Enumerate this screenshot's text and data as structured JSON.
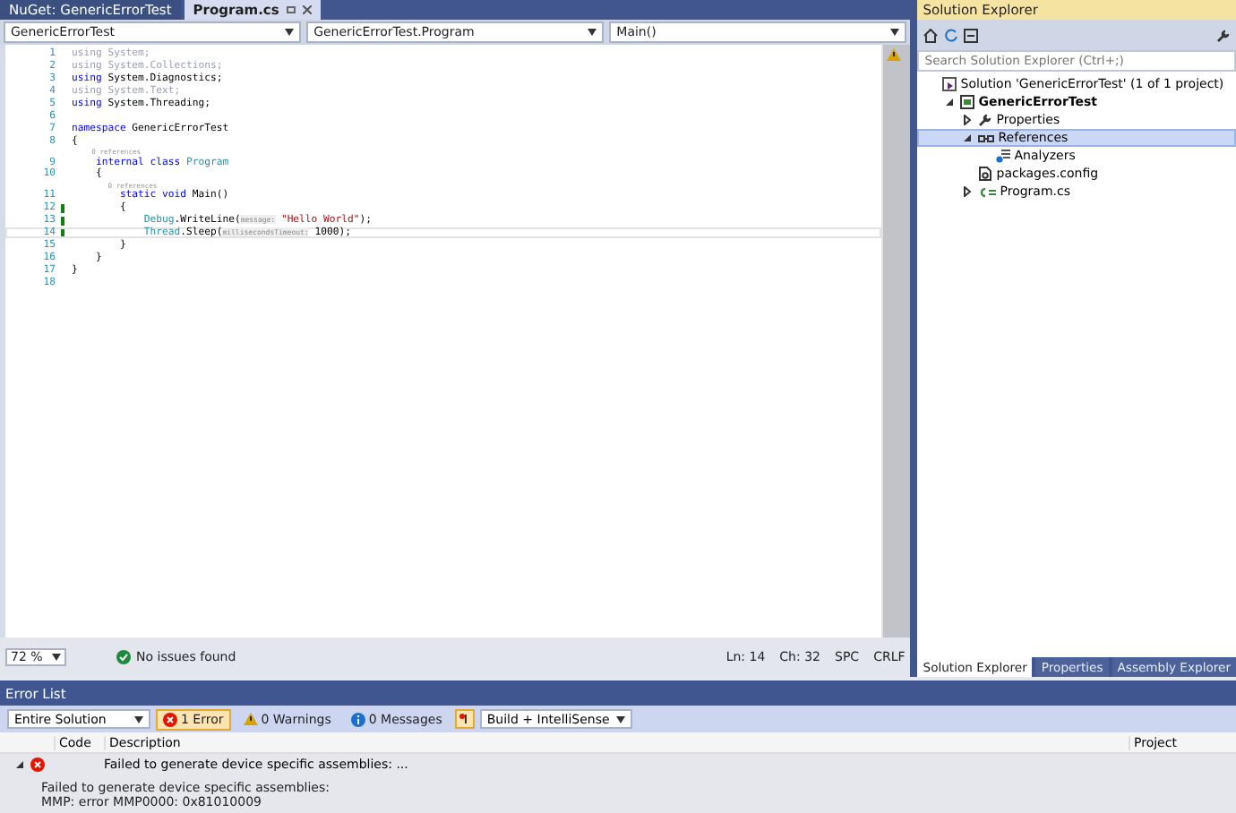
{
  "doc_tabs": [
    {
      "label": "NuGet: GenericErrorTest",
      "selected": false
    },
    {
      "label": "Program.cs",
      "selected": true
    }
  ],
  "nav_bar": [
    "GenericErrorTest",
    "GenericErrorTest.Program",
    "Main()"
  ],
  "code_lines": [
    {
      "kind": "code",
      "number": "1",
      "changed": false,
      "current": false,
      "tokens": [
        {
          "text": "using System;",
          "kind": "dim"
        }
      ]
    },
    {
      "kind": "code",
      "number": "2",
      "changed": false,
      "current": false,
      "tokens": [
        {
          "text": "using System.Collections;",
          "kind": "dim"
        }
      ]
    },
    {
      "kind": "code",
      "number": "3",
      "changed": false,
      "current": false,
      "tokens": [
        {
          "text": "using",
          "kind": "keyword"
        },
        {
          "text": " System.Diagnostics;",
          "kind": "plain"
        }
      ]
    },
    {
      "kind": "code",
      "number": "4",
      "changed": false,
      "current": false,
      "tokens": [
        {
          "text": "using System.Text;",
          "kind": "dim"
        }
      ]
    },
    {
      "kind": "code",
      "number": "5",
      "changed": false,
      "current": false,
      "tokens": [
        {
          "text": "using",
          "kind": "keyword"
        },
        {
          "text": " System.Threading;",
          "kind": "plain"
        }
      ]
    },
    {
      "kind": "code",
      "number": "6",
      "changed": false,
      "current": false
    },
    {
      "kind": "code",
      "number": "7",
      "changed": false,
      "current": false,
      "tokens": [
        {
          "text": "namespace",
          "kind": "keyword"
        },
        {
          "text": " GenericErrorTest",
          "kind": "plain"
        }
      ]
    },
    {
      "kind": "code",
      "number": "8",
      "changed": false,
      "current": false,
      "tokens": [
        {
          "text": "{",
          "kind": "plain"
        }
      ]
    },
    {
      "kind": "lens",
      "text": "    0 references"
    },
    {
      "kind": "code",
      "number": "9",
      "changed": false,
      "current": false,
      "tokens": [
        {
          "text": "    internal class ",
          "kind": "keyword"
        },
        {
          "text": "Program",
          "kind": "type"
        }
      ]
    },
    {
      "kind": "code",
      "number": "10",
      "changed": false,
      "current": false,
      "tokens": [
        {
          "text": "    {",
          "kind": "plain"
        }
      ]
    },
    {
      "kind": "lens",
      "text": "        0 references"
    },
    {
      "kind": "code",
      "number": "11",
      "changed": false,
      "current": false,
      "tokens": [
        {
          "text": "        static void",
          "kind": "keyword"
        },
        {
          "text": " Main()",
          "kind": "plain"
        }
      ]
    },
    {
      "kind": "code",
      "number": "12",
      "changed": true,
      "current": false,
      "tokens": [
        {
          "text": "        {",
          "kind": "plain"
        }
      ]
    },
    {
      "kind": "code",
      "number": "13",
      "changed": true,
      "current": false,
      "tokens": [
        {
          "text": "            Debug",
          "kind": "type"
        },
        {
          "text": ".WriteLine(",
          "kind": "plain"
        },
        {
          "text": "message:",
          "kind": "hint"
        },
        {
          "text": " \"Hello World\"",
          "kind": "string"
        },
        {
          "text": ");",
          "kind": "plain"
        }
      ]
    },
    {
      "kind": "code",
      "number": "14",
      "changed": true,
      "current": true,
      "tokens": [
        {
          "text": "            Thread",
          "kind": "type"
        },
        {
          "text": ".Sleep(",
          "kind": "plain"
        },
        {
          "text": "millisecondsTimeout:",
          "kind": "hint"
        },
        {
          "text": " 1000);",
          "kind": "plain"
        }
      ]
    },
    {
      "kind": "code",
      "number": "15",
      "changed": false,
      "current": false,
      "tokens": [
        {
          "text": "        }",
          "kind": "plain"
        }
      ]
    },
    {
      "kind": "code",
      "number": "16",
      "changed": false,
      "current": false,
      "tokens": [
        {
          "text": "    }",
          "kind": "plain"
        }
      ]
    },
    {
      "kind": "code",
      "number": "17",
      "changed": false,
      "current": false,
      "tokens": [
        {
          "text": "}",
          "kind": "plain"
        }
      ]
    },
    {
      "kind": "code",
      "number": "18",
      "changed": false,
      "current": false
    }
  ],
  "editor_status": {
    "zoom": "72 %",
    "issues": "No issues found",
    "line": "Ln: 14",
    "column": "Ch: 32",
    "indent": "SPC",
    "line_endings": "CRLF"
  },
  "solution_explorer": {
    "title": "Solution Explorer",
    "search": {
      "placeholder": "Search Solution Explorer (Ctrl+;)"
    },
    "tree": [
      {
        "label": "Solution 'GenericErrorTest' (1 of 1 project)",
        "kind": "solution",
        "selected": false,
        "children": [
          {
            "label": "GenericErrorTest",
            "kind": "project",
            "bold": true,
            "expanded": true,
            "selected": false,
            "children": [
              {
                "label": "Properties",
                "kind": "properties",
                "expanded": false,
                "selected": false
              },
              {
                "label": "References",
                "kind": "references",
                "expanded": true,
                "selected": true,
                "children": [
                  {
                    "label": "Analyzers",
                    "kind": "analyzers",
                    "selected": false
                  }
                ]
              },
              {
                "label": "packages.config",
                "kind": "config",
                "selected": false
              },
              {
                "label": "Program.cs",
                "kind": "csharp",
                "expanded": false,
                "selected": false
              }
            ]
          }
        ]
      }
    ],
    "tabs": [
      {
        "label": "Solution Explorer",
        "selected": true
      },
      {
        "label": "Properties",
        "selected": false
      },
      {
        "label": "Assembly Explorer",
        "selected": false
      }
    ]
  },
  "error_list": {
    "title": "Error List",
    "scope": "Entire Solution",
    "filters": [
      {
        "kind": "error",
        "label": "1 Error",
        "selected": true
      },
      {
        "kind": "warning",
        "label": "0 Warnings",
        "selected": false
      },
      {
        "kind": "message",
        "label": "0 Messages",
        "selected": false
      }
    ],
    "source": "Build + IntelliSense",
    "columns": [
      "Code",
      "Description",
      "Project"
    ],
    "rows": [
      {
        "expanded": true,
        "description": "Failed to generate device specific assemblies: ...",
        "details": [
          "Failed to generate device specific assemblies:",
          "MMP: error MMP0000: 0x81010009"
        ]
      }
    ]
  }
}
